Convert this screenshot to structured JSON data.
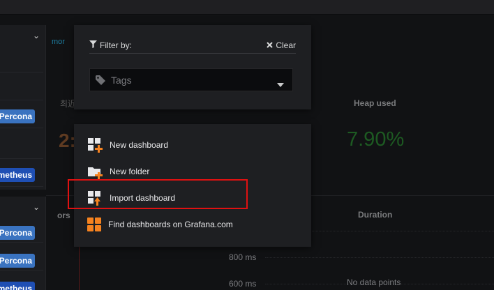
{
  "background": {
    "left_tags": [
      "Percona",
      "metheus",
      "Percona",
      "Percona",
      "metheus"
    ],
    "chip_text": "mor",
    "cjk_text": "최近",
    "big_number": "2:",
    "heap_title": "Heap used",
    "heap_value": "7.90%",
    "errors_title": "ors",
    "duration_title": "Duration",
    "axis_800": "800 ms",
    "axis_600": "600 ms",
    "no_data": "No data points"
  },
  "filter": {
    "label": "Filter by:",
    "clear_label": "Clear",
    "tags_placeholder": "Tags"
  },
  "new_menu": {
    "items": [
      {
        "label": "New dashboard",
        "icon": "new-dashboard-icon"
      },
      {
        "label": "New folder",
        "icon": "new-folder-icon"
      },
      {
        "label": "Import dashboard",
        "icon": "import-dashboard-icon"
      },
      {
        "label": "Find dashboards on Grafana.com",
        "icon": "grafana-com-icon"
      }
    ]
  },
  "colors": {
    "accent_orange": "#f5821f",
    "highlight_red": "#e01111",
    "tag_blue": "#3a73c0"
  }
}
